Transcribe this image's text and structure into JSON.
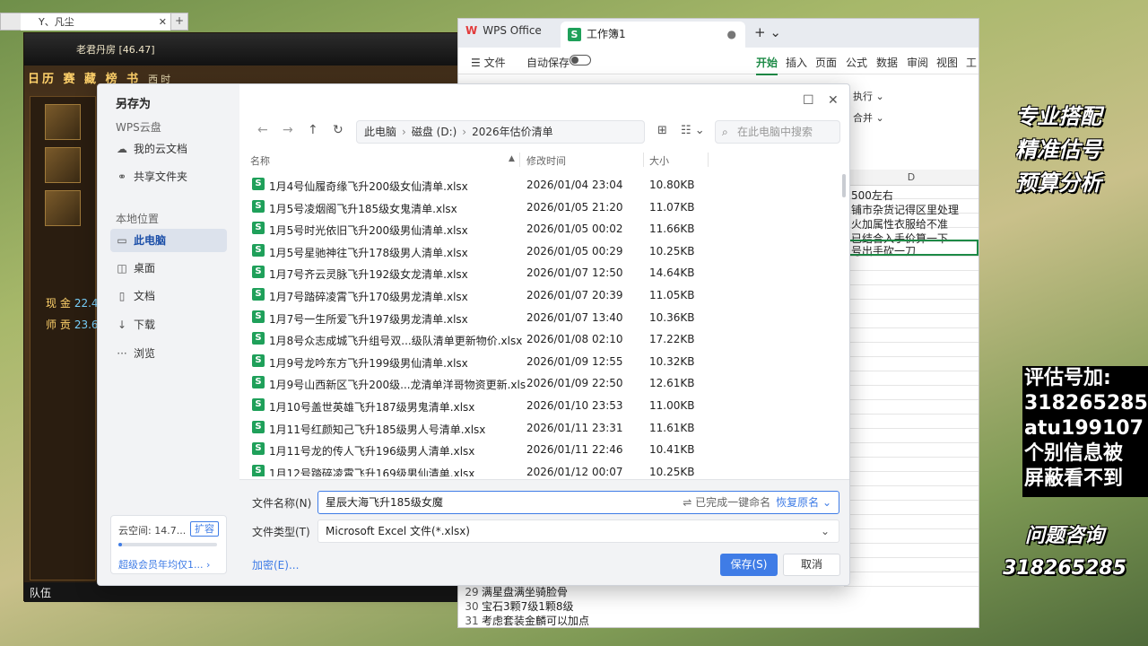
{
  "game": {
    "tab_title": "Y、凡尘",
    "tab_close": "✕",
    "new_tab": "+",
    "server": "老君丹房 [46.47]",
    "menu": "日历 赛 藏 榜 书",
    "menu_extra": "西时",
    "stat_cash_label": "现 金",
    "stat_cash_val": "22.4",
    "stat_master_label": "师 贡",
    "stat_master_val": "23.6",
    "bottom_label": "队伍"
  },
  "wps": {
    "tab_home": "WPS Office",
    "tab_home_logo": "W",
    "tab_sheet": "工作簿1",
    "sheet_badge": "S",
    "tab_dot": "●",
    "plus": "+ ⌄",
    "ribbon": {
      "file": "☰ 文件",
      "autosave": "自动保存",
      "tabs": [
        "开始",
        "插入",
        "页面",
        "公式",
        "数据",
        "审阅",
        "视图",
        "工"
      ]
    },
    "tools": {
      "line1": "执行 ⌄",
      "line2": "合并 ⌄"
    },
    "col_header": "D",
    "cells": [
      "500左右",
      "铺市杂货记得区里处理",
      "火加属性衣服给不准",
      "已结合入手价算一下",
      "号出手砍一刀"
    ],
    "bottom_rows": [
      {
        "num": "29",
        "text": "满星盘满坐骑脸骨"
      },
      {
        "num": "30",
        "text": "宝石3颗7级1颗8级"
      },
      {
        "num": "31",
        "text": "考虑套装金麟可以加点"
      }
    ]
  },
  "overlay": {
    "slogans": [
      "专业搭配",
      "精准估号",
      "预算分析"
    ],
    "black_lines": [
      "评估号加:",
      "318265285",
      "atu199107",
      "个别信息被",
      "屏蔽看不到"
    ],
    "contact": [
      "问题咨询",
      "318265285"
    ]
  },
  "dialog": {
    "title": "另存为",
    "maximize": "☐",
    "close": "✕",
    "sidebar": {
      "cloud_section": "WPS云盘",
      "cloud_items": [
        {
          "icon": "☁",
          "label": "我的云文档"
        },
        {
          "icon": "⚭",
          "label": "共享文件夹"
        }
      ],
      "local_section": "本地位置",
      "local_items": [
        {
          "icon": "▭",
          "label": "此电脑"
        },
        {
          "icon": "◫",
          "label": "桌面"
        },
        {
          "icon": "▯",
          "label": "文档"
        },
        {
          "icon": "↓",
          "label": "下载"
        },
        {
          "icon": "···",
          "label": "浏览"
        }
      ],
      "cloud_space": "云空间: 14.7...",
      "expand": "扩容",
      "cloud_usage_pct": 4,
      "vip": "超级会员年均仅1... ›"
    },
    "nav": {
      "back": "←",
      "forward": "→",
      "up": "↑",
      "refresh": "↻",
      "breadcrumb": [
        "此电脑",
        "磁盘 (D:)",
        "2026年估价清单"
      ],
      "breadcrumb_sep": "›",
      "new_folder": "⊞",
      "view": "☷ ⌄",
      "search_icon": "⌕",
      "search_placeholder": "在此电脑中搜索"
    },
    "columns": {
      "name": "名称",
      "sort": "▲",
      "modified": "修改时间",
      "size": "大小"
    },
    "files": [
      {
        "name": "1月4号仙履奇缘飞升200级女仙清单.xlsx",
        "date": "2026/01/04 23:04",
        "size": "10.80KB"
      },
      {
        "name": "1月5号凌烟阁飞升185级女鬼清单.xlsx",
        "date": "2026/01/05 21:20",
        "size": "11.07KB"
      },
      {
        "name": "1月5号时光依旧飞升200级男仙清单.xlsx",
        "date": "2026/01/05 00:02",
        "size": "11.66KB"
      },
      {
        "name": "1月5号星驰神往飞升178级男人清单.xlsx",
        "date": "2026/01/05 00:29",
        "size": "10.25KB"
      },
      {
        "name": "1月7号齐云灵脉飞升192级女龙清单.xlsx",
        "date": "2026/01/07 12:50",
        "size": "14.64KB"
      },
      {
        "name": "1月7号踏碎凌霄飞升170级男龙清单.xlsx",
        "date": "2026/01/07 20:39",
        "size": "11.05KB"
      },
      {
        "name": "1月7号一生所爱飞升197级男龙清单.xlsx",
        "date": "2026/01/07 13:40",
        "size": "10.36KB"
      },
      {
        "name": "1月8号众志成城飞升组号双...级队清单更新物价.xlsx",
        "date": "2026/01/08 02:10",
        "size": "17.22KB"
      },
      {
        "name": "1月9号龙吟东方飞升199级男仙清单.xlsx",
        "date": "2026/01/09 12:55",
        "size": "10.32KB"
      },
      {
        "name": "1月9号山西新区飞升200级...龙清单洋哥物资更新.xlsx",
        "date": "2026/01/09 22:50",
        "size": "12.61KB"
      },
      {
        "name": "1月10号盖世英雄飞升187级男鬼清单.xlsx",
        "date": "2026/01/10 23:53",
        "size": "11.00KB"
      },
      {
        "name": "1月11号红颜知己飞升185级男人号清单.xlsx",
        "date": "2026/01/11 23:31",
        "size": "11.61KB"
      },
      {
        "name": "1月11号龙的传人飞升196级男人清单.xlsx",
        "date": "2026/01/11 22:46",
        "size": "10.41KB"
      },
      {
        "name": "1月12号踏碎凌霄飞升169级男仙清单.xlsx",
        "date": "2026/01/12 00:07",
        "size": "10.25KB"
      }
    ],
    "footer": {
      "filename_label": "文件名称(N)",
      "filename_value": "星辰大海飞升185级女魔",
      "rename_icon": "⇌",
      "rename_done": "已完成一键命名",
      "restore": "恢复原名 ⌄",
      "filetype_label": "文件类型(T)",
      "filetype_value": "Microsoft Excel 文件(*.xlsx)",
      "chevron": "⌄",
      "encrypt": "加密(E)...",
      "save": "保存(S)",
      "cancel": "取消"
    }
  }
}
